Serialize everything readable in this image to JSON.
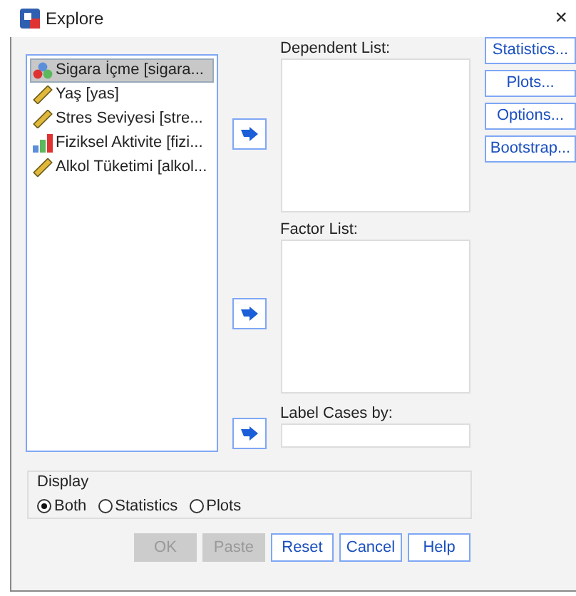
{
  "window": {
    "title": "Explore",
    "close": "×"
  },
  "variables": [
    {
      "label": "Sigara İçme [sigara...",
      "kind": "nominal",
      "selected": true
    },
    {
      "label": "Yaş [yas]",
      "kind": "scale",
      "selected": false
    },
    {
      "label": "Stres Seviyesi [stre...",
      "kind": "scale",
      "selected": false
    },
    {
      "label": "Fiziksel Aktivite [fizi...",
      "kind": "ordinal",
      "selected": false
    },
    {
      "label": "Alkol Tüketimi [alkol...",
      "kind": "scale",
      "selected": false
    }
  ],
  "dependent_list": {
    "label": "Dependent List:"
  },
  "factor_list": {
    "label": "Factor List:"
  },
  "label_cases": {
    "label": "Label Cases by:"
  },
  "side_buttons": [
    "Statistics...",
    "Plots...",
    "Options...",
    "Bootstrap..."
  ],
  "display": {
    "title": "Display",
    "options": [
      {
        "label": "Both",
        "selected": true
      },
      {
        "label": "Statistics",
        "selected": false
      },
      {
        "label": "Plots",
        "selected": false
      }
    ]
  },
  "buttons": [
    {
      "label": "OK",
      "disabled": true
    },
    {
      "label": "Paste",
      "disabled": true
    },
    {
      "label": "Reset",
      "disabled": false
    },
    {
      "label": "Cancel",
      "disabled": false
    },
    {
      "label": "Help",
      "disabled": false
    }
  ]
}
